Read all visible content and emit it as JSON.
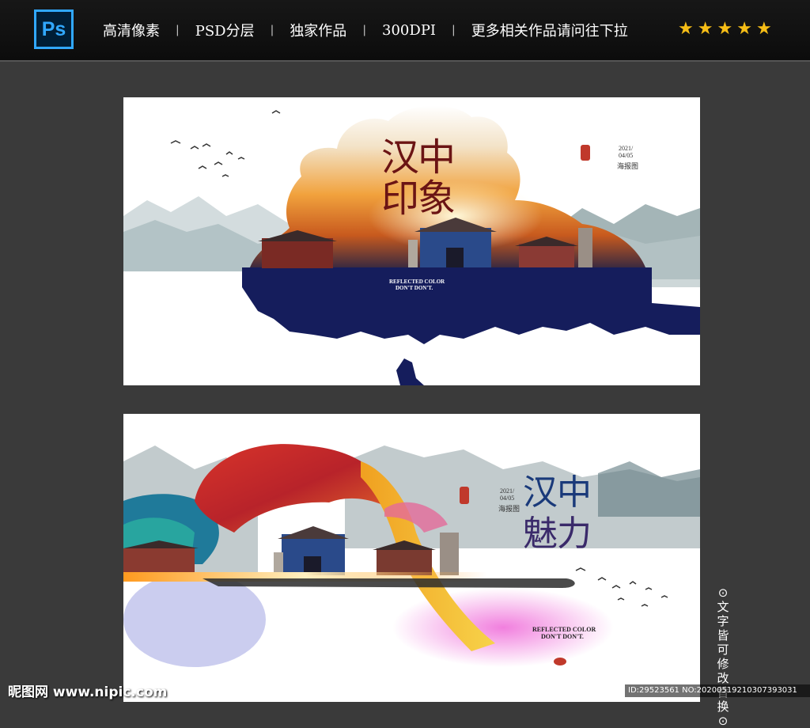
{
  "header": {
    "logo": "Ps",
    "items": [
      "高清像素",
      "PSD分层",
      "独家作品",
      "300DPI",
      "更多相关作品请问往下拉"
    ],
    "separator": "|",
    "star_count": 5,
    "star_color": "#f6bd16"
  },
  "poster1": {
    "title_line1": "汉中",
    "title_line2": "印象",
    "tagline1": "REFLECTED COLOR",
    "tagline2": "DON'T DON'T.",
    "date_line1": "2021/",
    "date_line2": "04/05",
    "caption": "海报图",
    "navy": "#151d5c"
  },
  "poster2": {
    "title_line1": "汉中",
    "title_line2": "魅力",
    "tagline1": "REFLECTED COLOR",
    "tagline2": "DON'T DON'T.",
    "date_line1": "2021/",
    "date_line2": "04/05",
    "caption": "海报图"
  },
  "side_note": "⊙文字皆可修改替换⊙",
  "watermark_left": "昵图网 www.nipic.com",
  "watermark_right": "ID:29523561 NO:20200519210307393031"
}
